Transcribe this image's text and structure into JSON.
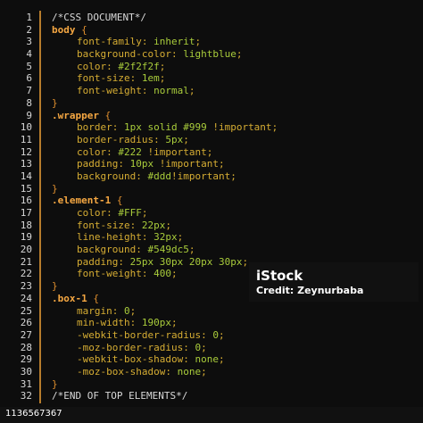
{
  "editor": {
    "lines": [
      {
        "n": "1",
        "parts": [
          [
            "comment",
            "/*CSS DOCUMENT*/"
          ]
        ]
      },
      {
        "n": "2",
        "parts": [
          [
            "selector",
            "body"
          ],
          [
            "text",
            " "
          ],
          [
            "brace",
            "{"
          ]
        ]
      },
      {
        "n": "3",
        "indent": true,
        "parts": [
          [
            "prop",
            "font-family:"
          ],
          [
            "text",
            " "
          ],
          [
            "val",
            "inherit"
          ],
          [
            "punc",
            ";"
          ]
        ]
      },
      {
        "n": "4",
        "indent": true,
        "parts": [
          [
            "prop",
            "background-color:"
          ],
          [
            "text",
            " "
          ],
          [
            "val",
            "lightblue"
          ],
          [
            "punc",
            ";"
          ]
        ]
      },
      {
        "n": "5",
        "indent": true,
        "parts": [
          [
            "prop",
            "color:"
          ],
          [
            "text",
            " "
          ],
          [
            "val",
            "#2f2f2f"
          ],
          [
            "punc",
            ";"
          ]
        ]
      },
      {
        "n": "6",
        "indent": true,
        "parts": [
          [
            "prop",
            "font-size:"
          ],
          [
            "text",
            " "
          ],
          [
            "val",
            "1em"
          ],
          [
            "punc",
            ";"
          ]
        ]
      },
      {
        "n": "7",
        "indent": true,
        "parts": [
          [
            "prop",
            "font-weight:"
          ],
          [
            "text",
            " "
          ],
          [
            "val",
            "normal"
          ],
          [
            "punc",
            ";"
          ]
        ]
      },
      {
        "n": "8",
        "parts": [
          [
            "brace",
            "}"
          ]
        ]
      },
      {
        "n": "9",
        "parts": [
          [
            "selector",
            ".wrapper"
          ],
          [
            "text",
            " "
          ],
          [
            "brace",
            "{"
          ]
        ]
      },
      {
        "n": "10",
        "indent": true,
        "parts": [
          [
            "prop",
            "border:"
          ],
          [
            "text",
            " "
          ],
          [
            "val",
            "1px solid #999"
          ],
          [
            "text",
            " "
          ],
          [
            "imp",
            "!important"
          ],
          [
            "punc",
            ";"
          ]
        ]
      },
      {
        "n": "11",
        "indent": true,
        "parts": [
          [
            "prop",
            "border-radius:"
          ],
          [
            "text",
            " "
          ],
          [
            "val",
            "5px"
          ],
          [
            "punc",
            ";"
          ]
        ]
      },
      {
        "n": "12",
        "indent": true,
        "parts": [
          [
            "prop",
            "color:"
          ],
          [
            "text",
            " "
          ],
          [
            "val",
            "#222"
          ],
          [
            "text",
            " "
          ],
          [
            "imp",
            "!important"
          ],
          [
            "punc",
            ";"
          ]
        ]
      },
      {
        "n": "13",
        "indent": true,
        "parts": [
          [
            "prop",
            "padding:"
          ],
          [
            "text",
            " "
          ],
          [
            "val",
            "10px"
          ],
          [
            "text",
            " "
          ],
          [
            "imp",
            "!important"
          ],
          [
            "punc",
            ";"
          ]
        ]
      },
      {
        "n": "14",
        "indent": true,
        "parts": [
          [
            "prop",
            "background:"
          ],
          [
            "text",
            " "
          ],
          [
            "val",
            "#ddd"
          ],
          [
            "imp",
            "!important"
          ],
          [
            "punc",
            ";"
          ]
        ]
      },
      {
        "n": "15",
        "parts": [
          [
            "brace",
            "}"
          ]
        ]
      },
      {
        "n": "16",
        "parts": [
          [
            "selector",
            ".element-1"
          ],
          [
            "text",
            " "
          ],
          [
            "brace",
            "{"
          ]
        ]
      },
      {
        "n": "17",
        "indent": true,
        "parts": [
          [
            "prop",
            "color:"
          ],
          [
            "text",
            " "
          ],
          [
            "val",
            "#FFF"
          ],
          [
            "punc",
            ";"
          ]
        ]
      },
      {
        "n": "18",
        "indent": true,
        "parts": [
          [
            "prop",
            "font-size:"
          ],
          [
            "text",
            " "
          ],
          [
            "val",
            "22px"
          ],
          [
            "punc",
            ";"
          ]
        ]
      },
      {
        "n": "19",
        "indent": true,
        "parts": [
          [
            "prop",
            "line-height:"
          ],
          [
            "text",
            " "
          ],
          [
            "val",
            "32px"
          ],
          [
            "punc",
            ";"
          ]
        ]
      },
      {
        "n": "20",
        "indent": true,
        "parts": [
          [
            "prop",
            "background:"
          ],
          [
            "text",
            " "
          ],
          [
            "val",
            "#549dc5"
          ],
          [
            "punc",
            ";"
          ]
        ]
      },
      {
        "n": "21",
        "indent": true,
        "parts": [
          [
            "prop",
            "padding:"
          ],
          [
            "text",
            " "
          ],
          [
            "val",
            "25px 30px 20px 30px"
          ],
          [
            "punc",
            ";"
          ]
        ]
      },
      {
        "n": "22",
        "indent": true,
        "parts": [
          [
            "prop",
            "font-weight:"
          ],
          [
            "text",
            " "
          ],
          [
            "val",
            "400"
          ],
          [
            "punc",
            ";"
          ]
        ]
      },
      {
        "n": "23",
        "parts": [
          [
            "brace",
            "}"
          ]
        ]
      },
      {
        "n": "24",
        "parts": [
          [
            "selector",
            ".box-1"
          ],
          [
            "text",
            " "
          ],
          [
            "brace",
            "{"
          ]
        ]
      },
      {
        "n": "25",
        "indent": true,
        "parts": [
          [
            "prop",
            "margin:"
          ],
          [
            "text",
            " "
          ],
          [
            "val",
            "0"
          ],
          [
            "punc",
            ";"
          ]
        ]
      },
      {
        "n": "26",
        "indent": true,
        "parts": [
          [
            "prop",
            "min-width:"
          ],
          [
            "text",
            " "
          ],
          [
            "val",
            "190px"
          ],
          [
            "punc",
            ";"
          ]
        ]
      },
      {
        "n": "27",
        "indent": true,
        "parts": [
          [
            "prop",
            "-webkit-border-radius:"
          ],
          [
            "text",
            " "
          ],
          [
            "val",
            "0"
          ],
          [
            "punc",
            ";"
          ]
        ]
      },
      {
        "n": "28",
        "indent": true,
        "parts": [
          [
            "prop",
            "-moz-border-radius:"
          ],
          [
            "text",
            " "
          ],
          [
            "val",
            "0"
          ],
          [
            "punc",
            ";"
          ]
        ]
      },
      {
        "n": "29",
        "indent": true,
        "parts": [
          [
            "prop",
            "-webkit-box-shadow:"
          ],
          [
            "text",
            " "
          ],
          [
            "val",
            "none"
          ],
          [
            "punc",
            ";"
          ]
        ]
      },
      {
        "n": "30",
        "indent": true,
        "parts": [
          [
            "prop",
            "-moz-box-shadow:"
          ],
          [
            "text",
            " "
          ],
          [
            "val",
            "none"
          ],
          [
            "punc",
            ";"
          ]
        ]
      },
      {
        "n": "31",
        "parts": [
          [
            "brace",
            "}"
          ]
        ]
      },
      {
        "n": "32",
        "parts": [
          [
            "comment",
            "/*END OF TOP ELEMENTS*/"
          ]
        ]
      }
    ]
  },
  "watermark": {
    "logo": "iStock",
    "credit": "Credit: Zeynurbaba"
  },
  "footer": {
    "image_id": "1136567367"
  }
}
